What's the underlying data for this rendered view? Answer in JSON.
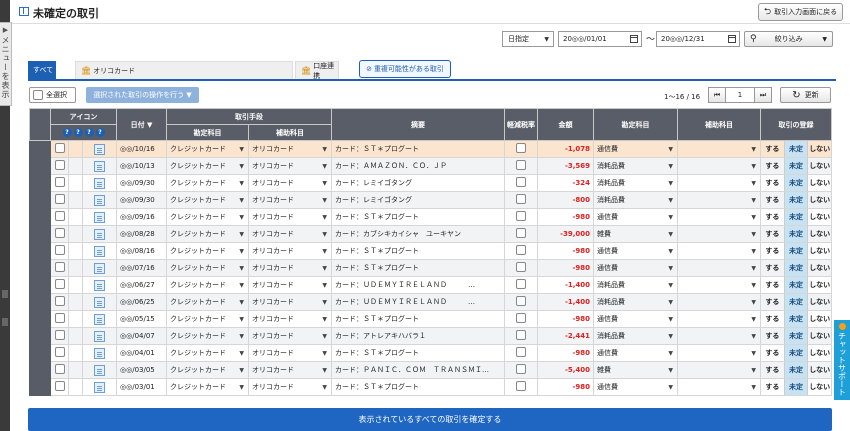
{
  "page_title": "未確定の取引",
  "return_button": "取引入力画面に戻る",
  "left_menu": "メニューを表示",
  "filters": {
    "date_type": "日指定",
    "date_from": "20◎◎/01/01",
    "tilde": "〜",
    "date_to": "20◎◎/12/31",
    "filter_button": "絞り込み"
  },
  "tabs": {
    "all": "すべて",
    "card": "オリコカード",
    "bank": "口座連携"
  },
  "duplicate_button": "重複可能性がある取引",
  "select_all": "全選択",
  "bulk_action": "選択された取引の操作を行う ▼",
  "pagination": {
    "range": "1〜16 / 16",
    "page": "1"
  },
  "refresh": "更新",
  "table": {
    "h_icon": "アイコン",
    "h_date": "日付 ▼",
    "h_method": "取引手段",
    "h_account": "勘定科目",
    "h_sub": "補助科目",
    "h_summary": "摘要",
    "h_reduced": "軽減税率",
    "h_amount": "金額",
    "h_account2": "勘定科目",
    "h_sub2": "補助科目",
    "h_register": "取引の登録",
    "q": "?",
    "reg_yes": "する",
    "reg_pending": "未定",
    "reg_no": "しない",
    "rows": [
      {
        "date": "◎◎/10/16",
        "account": "クレジットカード",
        "sub": "オリコカード",
        "summary": "カード：ＳＴ＊プログート",
        "amount": "-1,078",
        "cat": "通信費",
        "sel": true
      },
      {
        "date": "◎◎/10/13",
        "account": "クレジットカード",
        "sub": "オリコカード",
        "summary": "カード：ＡＭＡＺＯＮ．ＣＯ．ＪＰ",
        "amount": "-3,569",
        "cat": "消耗品費",
        "sel": false
      },
      {
        "date": "◎◎/09/30",
        "account": "クレジットカード",
        "sub": "オリコカード",
        "summary": "カード：レミイゴタング",
        "amount": "-324",
        "cat": "消耗品費",
        "sel": false
      },
      {
        "date": "◎◎/09/30",
        "account": "クレジットカード",
        "sub": "オリコカード",
        "summary": "カード：レミイゴタング",
        "amount": "-800",
        "cat": "消耗品費",
        "sel": false
      },
      {
        "date": "◎◎/09/16",
        "account": "クレジットカード",
        "sub": "オリコカード",
        "summary": "カード：ＳＴ＊プログート",
        "amount": "-980",
        "cat": "通信費",
        "sel": false
      },
      {
        "date": "◎◎/08/28",
        "account": "クレジットカード",
        "sub": "オリコカード",
        "summary": "カード：カブシキカイシャ　ユーキヤン",
        "amount": "-39,000",
        "cat": "雑費",
        "sel": false
      },
      {
        "date": "◎◎/08/16",
        "account": "クレジットカード",
        "sub": "オリコカード",
        "summary": "カード：ＳＴ＊プログート",
        "amount": "-980",
        "cat": "通信費",
        "sel": false
      },
      {
        "date": "◎◎/07/16",
        "account": "クレジットカード",
        "sub": "オリコカード",
        "summary": "カード：ＳＴ＊プログート",
        "amount": "-980",
        "cat": "通信費",
        "sel": false
      },
      {
        "date": "◎◎/06/27",
        "account": "クレジットカード",
        "sub": "オリコカード",
        "summary": "カード：ＵＤＥＭＹＩＲＥＬＡＮＤ　　　…",
        "amount": "-1,400",
        "cat": "消耗品費",
        "sel": false
      },
      {
        "date": "◎◎/06/25",
        "account": "クレジットカード",
        "sub": "オリコカード",
        "summary": "カード：ＵＤＥＭＹＩＲＥＬＡＮＤ　　　…",
        "amount": "-1,400",
        "cat": "消耗品費",
        "sel": false
      },
      {
        "date": "◎◎/05/15",
        "account": "クレジットカード",
        "sub": "オリコカード",
        "summary": "カード：ＳＴ＊プログート",
        "amount": "-980",
        "cat": "通信費",
        "sel": false
      },
      {
        "date": "◎◎/04/07",
        "account": "クレジットカード",
        "sub": "オリコカード",
        "summary": "カード：アトレアキハバラ１",
        "amount": "-2,441",
        "cat": "消耗品費",
        "sel": false
      },
      {
        "date": "◎◎/04/01",
        "account": "クレジットカード",
        "sub": "オリコカード",
        "summary": "カード：ＳＴ＊プログート",
        "amount": "-980",
        "cat": "通信費",
        "sel": false
      },
      {
        "date": "◎◎/03/05",
        "account": "クレジットカード",
        "sub": "オリコカード",
        "summary": "カード：ＰＡＮＩＣ．ＣＯＭ　ＴＲＡＮＳＭＩ…",
        "amount": "-5,400",
        "cat": "雑費",
        "sel": false
      },
      {
        "date": "◎◎/03/01",
        "account": "クレジットカード",
        "sub": "オリコカード",
        "summary": "カード：ＳＴ＊プログート",
        "amount": "-980",
        "cat": "通信費",
        "sel": false
      }
    ]
  },
  "chat_support": "チャットサポート",
  "confirm_all": "表示されているすべての取引を確定する"
}
